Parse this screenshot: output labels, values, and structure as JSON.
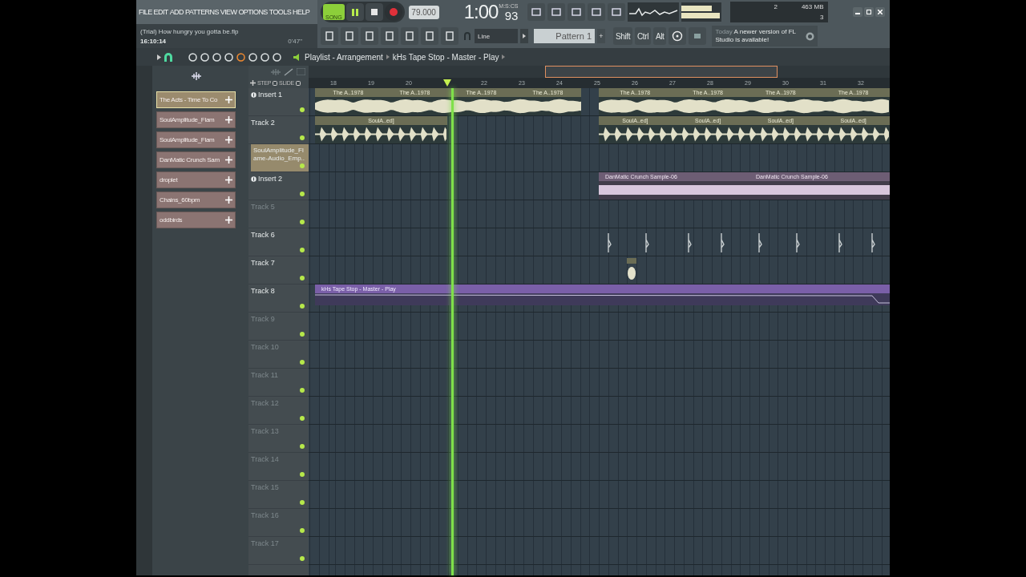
{
  "menu": [
    "FILE",
    "EDIT",
    "ADD",
    "PATTERNS",
    "VIEW",
    "OPTIONS",
    "TOOLS",
    "HELP"
  ],
  "project": {
    "title": "(Trial) How hungry you gotta be.flp",
    "clock": "16:10:14",
    "duration": "0'47\""
  },
  "transport": {
    "mode": {
      "label": "SONG",
      "selected": true
    },
    "playing": true,
    "tempo": "79.000",
    "time": "1:00",
    "time_cs": "93",
    "time_unit": "M:S:CS"
  },
  "snap": "Line",
  "pattern": {
    "name": "Pattern 1",
    "add": "+"
  },
  "modifier_keys": [
    "Shift",
    "Ctrl",
    "Alt"
  ],
  "news": {
    "day": "Today",
    "message": "A newer version of FL Studio is available!"
  },
  "cpu": {
    "cores": "2",
    "memory": "463 MB",
    "polyphony": "3"
  },
  "playlist": {
    "title": "Playlist - Arrangement",
    "target": "kHs Tape Stop - Master - Play"
  },
  "picker": [
    {
      "label": "The Acts - Time To Co",
      "selected": true
    },
    {
      "label": "SoulAmplitude_Flam",
      "selected": false
    },
    {
      "label": "SoulAmplitude_Flam",
      "selected": false
    },
    {
      "label": "DanMatic Crunch Sam",
      "selected": false
    },
    {
      "label": "droplet",
      "selected": false
    },
    {
      "label": "Chains_60bpm",
      "selected": false
    },
    {
      "label": "oddbirds",
      "selected": false
    }
  ],
  "ruler": {
    "step": "STEP",
    "slide": "SLIDE",
    "bars": [
      {
        "kind": "bar",
        "label": "18"
      },
      {
        "kind": "bar",
        "label": "19"
      },
      {
        "kind": "bar",
        "label": "20"
      },
      {
        "kind": "playhead"
      },
      {
        "kind": "bar",
        "label": "22"
      },
      {
        "kind": "bar",
        "label": "23"
      },
      {
        "kind": "bar",
        "label": "24"
      },
      {
        "kind": "bar",
        "label": "25"
      },
      {
        "kind": "bar",
        "label": "26"
      },
      {
        "kind": "bar",
        "label": "27"
      },
      {
        "kind": "bar",
        "label": "28"
      },
      {
        "kind": "bar",
        "label": "29"
      },
      {
        "kind": "bar",
        "label": "30"
      },
      {
        "kind": "bar",
        "label": "31"
      },
      {
        "kind": "bar",
        "label": "32"
      }
    ]
  },
  "tracks": [
    {
      "name": "Insert 1",
      "kind": "insert",
      "active": true,
      "clips": [
        {
          "kind": "audio",
          "labels": [
            "The A..1978",
            "The A..1978",
            "The A..1978",
            "The A..1978"
          ]
        },
        {
          "kind": "audio",
          "labels": [
            "The A..1978",
            "The A..1978",
            "The A..1978",
            "The A..1978"
          ]
        }
      ]
    },
    {
      "name": "Track 2",
      "kind": "track",
      "active": true,
      "clips": [
        {
          "kind": "beats",
          "labels": [
            "SoulA..ed]"
          ]
        },
        {
          "kind": "beats",
          "labels": [
            "SoulA..ed]",
            "SoulA..ed]",
            "SoulA..ed]",
            "SoulA..ed]"
          ]
        }
      ]
    },
    {
      "name": "SoulAmplitude_Flame-Audio_Emp..",
      "kind": "sample",
      "active": true
    },
    {
      "name": "Insert 2",
      "kind": "insert",
      "active": true,
      "clips": [
        {
          "kind": "sample",
          "labels": [
            "DanMatic Crunch Sample-06"
          ]
        },
        {
          "kind": "sample",
          "labels": [
            "DanMatic Crunch Sample-06"
          ]
        }
      ]
    },
    {
      "name": "Track 5",
      "kind": "track",
      "active": false
    },
    {
      "name": "Track 6",
      "kind": "track",
      "active": true,
      "clips": [
        {
          "kind": "ticks"
        }
      ]
    },
    {
      "name": "Track 7",
      "kind": "track",
      "active": true,
      "clips": [
        {
          "kind": "blip"
        }
      ]
    },
    {
      "name": "Track 8",
      "kind": "track",
      "active": true,
      "clips": [
        {
          "kind": "automation",
          "labels": [
            "kHs Tape Stop - Master - Play"
          ]
        }
      ]
    },
    {
      "name": "Track 9",
      "kind": "track",
      "active": false
    },
    {
      "name": "Track 10",
      "kind": "track",
      "active": false
    },
    {
      "name": "Track 11",
      "kind": "track",
      "active": false
    },
    {
      "name": "Track 12",
      "kind": "track",
      "active": false
    },
    {
      "name": "Track 13",
      "kind": "track",
      "active": false
    },
    {
      "name": "Track 14",
      "kind": "track",
      "active": false
    },
    {
      "name": "Track 15",
      "kind": "track",
      "active": false
    },
    {
      "name": "Track 16",
      "kind": "track",
      "active": false
    },
    {
      "name": "Track 17",
      "kind": "track",
      "active": false
    }
  ]
}
